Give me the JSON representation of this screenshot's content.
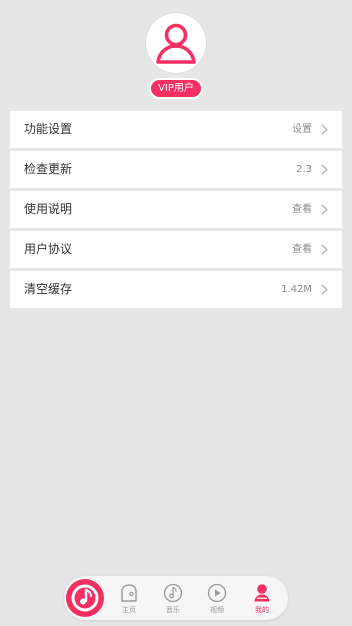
{
  "profile": {
    "badge": "VIP用户"
  },
  "settings": [
    {
      "label": "功能设置",
      "value": "设置"
    },
    {
      "label": "检查更新",
      "value": "2.3"
    },
    {
      "label": "使用说明",
      "value": "查看"
    },
    {
      "label": "用户协议",
      "value": "查看"
    },
    {
      "label": "清空缓存",
      "value": "1.42M"
    }
  ],
  "bottom_nav": {
    "items": [
      {
        "label": "主页",
        "icon": "home-icon"
      },
      {
        "label": "音乐",
        "icon": "music-icon"
      },
      {
        "label": "视频",
        "icon": "video-play-icon"
      },
      {
        "label": "我的",
        "icon": "user-icon",
        "active": true
      }
    ]
  },
  "colors": {
    "accent": "#f52f62",
    "background": "#e6e6e6",
    "row": "#ffffff",
    "muted": "#999999"
  }
}
